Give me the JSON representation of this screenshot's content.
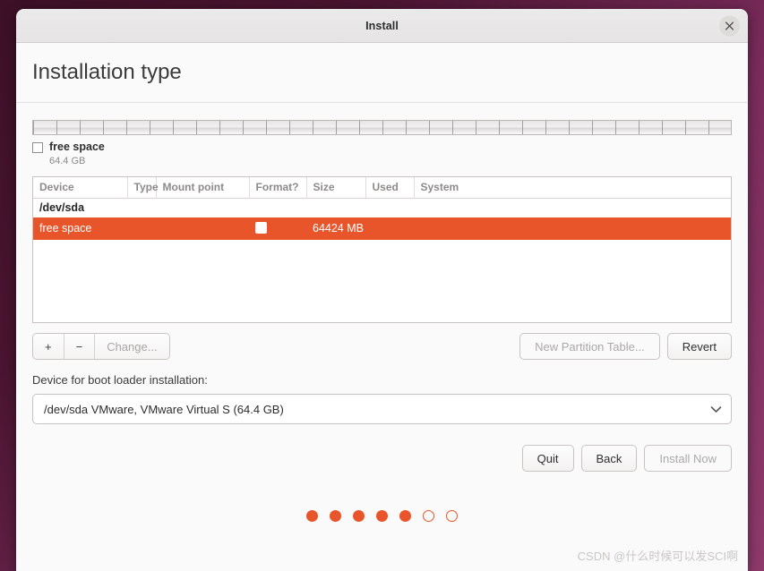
{
  "window": {
    "title": "Install",
    "close_icon": "close-icon"
  },
  "page": {
    "heading": "Installation type"
  },
  "disk": {
    "legend": {
      "name": "free space",
      "size": "64.4 GB"
    }
  },
  "partition_table": {
    "headers": [
      "Device",
      "Type",
      "Mount point",
      "Format?",
      "Size",
      "Used",
      "System"
    ],
    "rows": [
      {
        "type": "device",
        "device": "/dev/sda",
        "part_type": "",
        "mount_point": "",
        "format": "",
        "size": "",
        "used": "",
        "system": "",
        "selected": false
      },
      {
        "type": "partition",
        "device": "free space",
        "part_type": "",
        "mount_point": "",
        "format": "checkbox",
        "size": "64424 MB",
        "used": "",
        "system": "",
        "selected": true
      }
    ]
  },
  "toolbar": {
    "add_label": "+",
    "remove_label": "−",
    "change_label": "Change...",
    "new_partition_table_label": "New Partition Table...",
    "revert_label": "Revert"
  },
  "bootloader": {
    "label": "Device for boot loader installation:",
    "selected": "/dev/sda VMware, VMware Virtual S (64.4 GB)",
    "arrow_icon": "chevron-down-icon"
  },
  "actions": {
    "quit_label": "Quit",
    "back_label": "Back",
    "install_label": "Install Now"
  },
  "progress": {
    "total": 7,
    "completed": 5,
    "dots": [
      "filled",
      "filled",
      "filled",
      "filled",
      "filled",
      "hollow",
      "hollow"
    ]
  },
  "watermark": {
    "text": "CSDN @什么时候可以发SCI啊"
  },
  "colors": {
    "accent": "#e8552b",
    "desktop_background": "#4a1430",
    "window_background": "#fafafa"
  }
}
